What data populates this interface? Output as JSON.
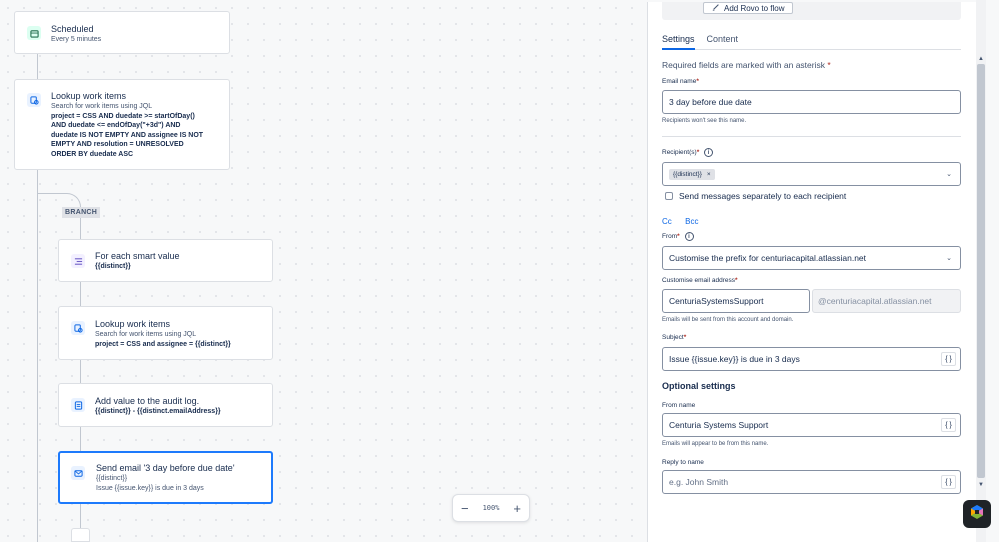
{
  "canvas": {
    "trigger": {
      "title": "Scheduled",
      "subtitle": "Every 5 minutes"
    },
    "lookup1": {
      "title": "Lookup work items",
      "subtitle": "Search for work items using JQL",
      "jql_lines": [
        "project = CSS AND duedate >= startOfDay()",
        "AND duedate <= endOfDay(\"+3d\") AND",
        "duedate IS NOT EMPTY AND assignee IS NOT",
        "EMPTY AND resolution = UNRESOLVED",
        "ORDER BY duedate ASC"
      ]
    },
    "branch_label": "BRANCH",
    "foreach": {
      "title": "For each smart value",
      "detail": "{{distinct}}"
    },
    "lookup2": {
      "title": "Lookup work items",
      "subtitle": "Search for work items using JQL",
      "jql": "project = CSS and assignee = {{distinct}}"
    },
    "audit": {
      "title": "Add value to the audit log.",
      "detail": "{{distinct}} - {{distinct.emailAddress}}"
    },
    "email": {
      "title": "Send email '3 day before due date'",
      "line1": "{{distinct}}",
      "line2": "Issue {{issue.key}} is due in 3 days"
    },
    "zoom": {
      "value": "100%",
      "minus": "−",
      "plus": "+"
    }
  },
  "panel": {
    "rovo_button": "Add Rovo to flow",
    "tabs": [
      {
        "label": "Settings",
        "active": true
      },
      {
        "label": "Content",
        "active": false
      }
    ],
    "required_note": "Required fields are marked with an asterisk",
    "email_name": {
      "label": "Email name",
      "value": "3 day before due date",
      "help": "Recipients won't see this name."
    },
    "recipients": {
      "label": "Recipient(s)",
      "chip": "{{distinct}}",
      "chip_remove": "×"
    },
    "send_separately": "Send messages separately to each recipient",
    "cc": "Cc",
    "bcc": "Bcc",
    "from": {
      "label": "From",
      "value": "Customise the prefix for centuriacapital.atlassian.net"
    },
    "custom_address": {
      "label": "Customise email address",
      "value": "CenturiaSystemsSupport",
      "domain": "@centuriacapital.atlassian.net",
      "help": "Emails will be sent from this account and domain."
    },
    "subject": {
      "label": "Subject",
      "value": "Issue {{issue.key}} is due in 3 days"
    },
    "optional_heading": "Optional settings",
    "from_name": {
      "label": "From name",
      "value": "Centuria Systems Support",
      "help": "Emails will appear to be from this name."
    },
    "reply_to": {
      "label": "Reply to name",
      "placeholder": "e.g. John Smith"
    },
    "code_glyph": "{ }",
    "asterisk": "*",
    "info_glyph": "i",
    "chevron_glyph": "⌄"
  },
  "icons": {
    "trigger": "calendar-icon",
    "lookup": "search-documents-icon",
    "foreach": "list-icon",
    "audit": "log-icon",
    "email": "envelope-icon",
    "rovo": "rovo-logo-icon"
  },
  "colors": {
    "accent": "#1d7afc",
    "trigger_icon_bg": "#dcfff1",
    "action_icon_bg": "#e9f2ff",
    "branch_icon_bg": "#f3f0ff"
  }
}
